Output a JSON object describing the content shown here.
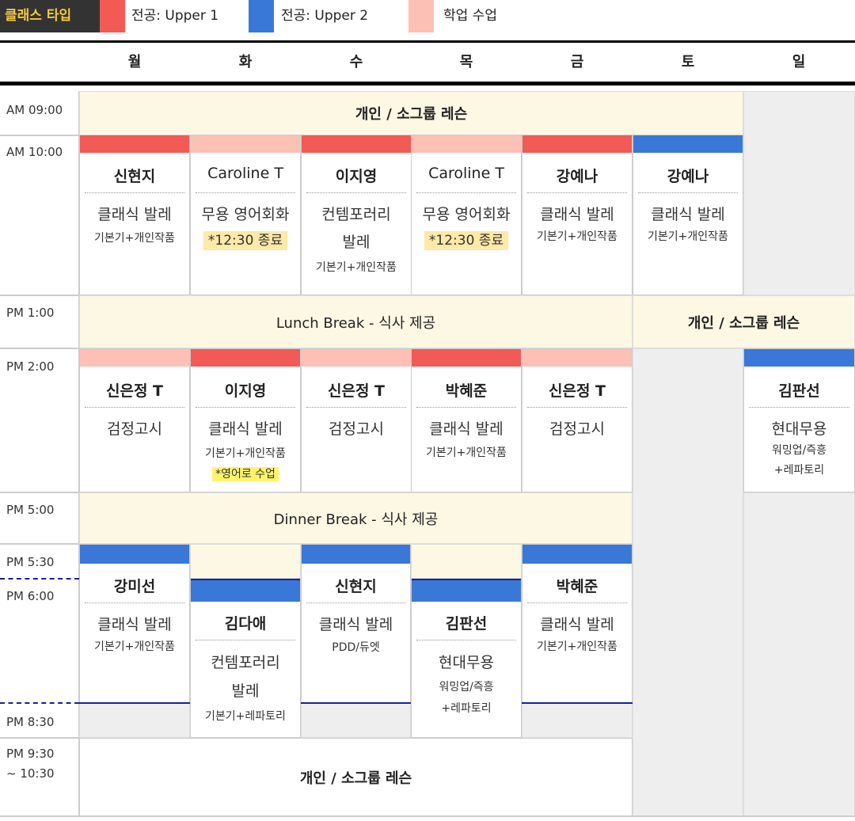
{
  "legend": {
    "title": "클래스 타입",
    "items": [
      {
        "label": "전공: Upper 1",
        "color": "#f15a55"
      },
      {
        "label": "전공: Upper 2",
        "color": "#3a78d8"
      },
      {
        "label": "학업 수업",
        "color": "#fcc0b5"
      }
    ]
  },
  "days": [
    "월",
    "화",
    "수",
    "목",
    "금",
    "토",
    "일"
  ],
  "times": {
    "t0900": "AM 09:00",
    "t1000": "AM 10:00",
    "t1300": "PM 1:00",
    "t1400": "PM 2:00",
    "t1700": "PM 5:00",
    "t1730": "PM 5:30",
    "t1800": "PM 6:00",
    "t2030": "PM 8:30",
    "t2130a": "PM 9:30",
    "t2130b": "~ 10:30"
  },
  "blocks": {
    "private_morning": "개인 / 소그룹 레슨",
    "lunch": "Lunch Break - 식사 제공",
    "private_sat": "개인 / 소그룹 레슨",
    "dinner": "Dinner Break - 식사 제공",
    "private_night": "개인 / 소그룹 레슨"
  },
  "morning": [
    {
      "teacher": "신현지",
      "subject": "클래식 발레",
      "note": "기본기+개인작품"
    },
    {
      "teacher": "Caroline T",
      "subject": "무용 영어회화",
      "note": "*12:30 종료"
    },
    {
      "teacher": "이지영",
      "subject": "컨템포러리",
      "subject2": "발레",
      "note": "기본기+개인작품"
    },
    {
      "teacher": "Caroline T",
      "subject": "무용 영어회화",
      "note": "*12:30 종료"
    },
    {
      "teacher": "강예나",
      "subject": "클래식 발레",
      "note": "기본기+개인작품"
    },
    {
      "teacher": "강예나",
      "subject": "클래식 발레",
      "note": "기본기+개인작품"
    }
  ],
  "afternoon": [
    {
      "teacher": "신은정 T",
      "subject": "검정고시"
    },
    {
      "teacher": "이지영",
      "subject": "클래식 발레",
      "note": "기본기+개인작품",
      "note2": "*영어로 수업"
    },
    {
      "teacher": "신은정 T",
      "subject": "검정고시"
    },
    {
      "teacher": "박혜준",
      "subject": "클래식 발레",
      "note": "기본기+개인작품"
    },
    {
      "teacher": "신은정 T",
      "subject": "검정고시"
    },
    {
      "teacher": "김판선",
      "subject": "현대무용",
      "note": "워밍업/즉흥",
      "note2": "+레파토리"
    }
  ],
  "evening": [
    {
      "teacher": "강미선",
      "subject": "클래식 발레",
      "note": "기본기+개인작품"
    },
    {
      "teacher": "김다애",
      "subject": "컨템포러리",
      "subject2": "발레",
      "note": "기본기+레파토리"
    },
    {
      "teacher": "신현지",
      "subject": "클래식 발레",
      "note": "PDD/듀엣"
    },
    {
      "teacher": "김판선",
      "subject": "현대무용",
      "note": "워밍업/즉흥",
      "note2": "+레파토리"
    },
    {
      "teacher": "박혜준",
      "subject": "클래식 발레",
      "note": "기본기+개인작품"
    }
  ]
}
